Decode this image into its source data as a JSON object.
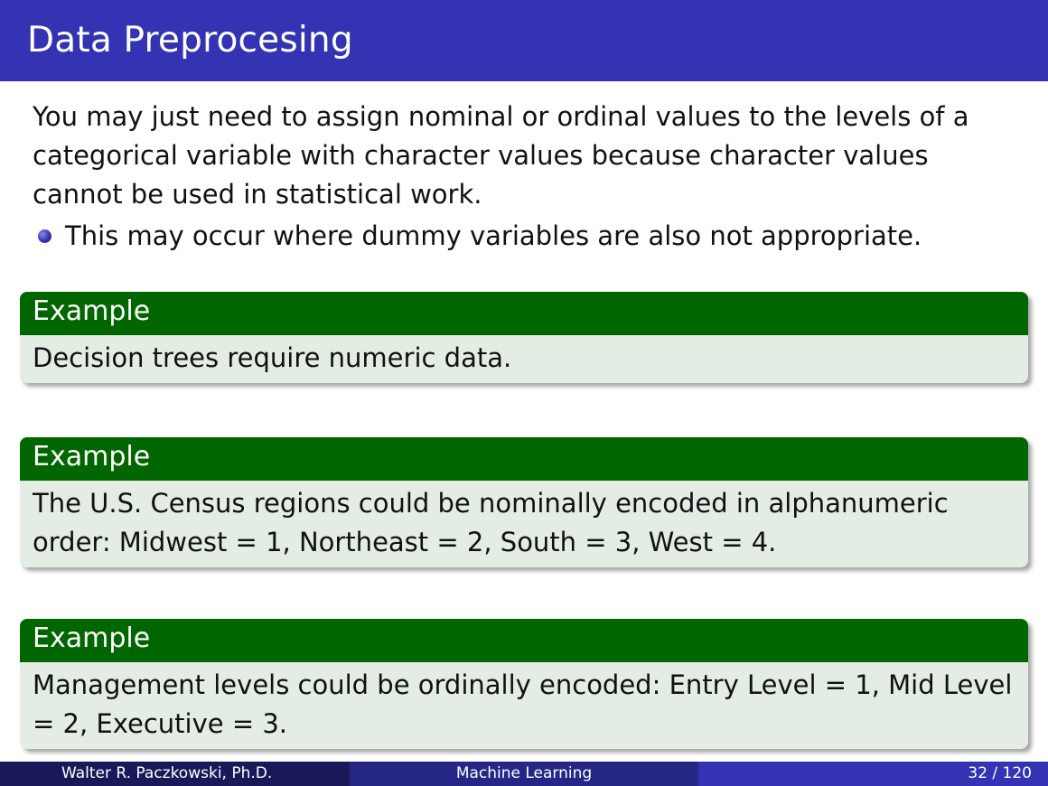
{
  "slide": {
    "title": "Data Preprocesing",
    "intro": "You may just need to assign nominal or ordinal values to the levels of a categorical variable with character values because character values cannot be used in statistical work.",
    "bullet": "This may occur where dummy variables are also not appropriate.",
    "blocks": [
      {
        "title": "Example",
        "text": "Decision trees require numeric data."
      },
      {
        "title": "Example",
        "text": "The U.S. Census regions could be nominally encoded in alphanumeric order: Midwest = 1, Northeast = 2, South = 3, West = 4."
      },
      {
        "title": "Example",
        "text": "Management levels could be ordinally encoded: Entry Level = 1, Mid Level = 2, Executive = 3."
      }
    ]
  },
  "footer": {
    "author": "Walter R. Paczkowski, Ph.D.",
    "course": "Machine Learning",
    "page": "32 / 120"
  },
  "colors": {
    "title_bar": "#3333b3",
    "block_header": "#006600",
    "block_body": "#e4ede4"
  }
}
